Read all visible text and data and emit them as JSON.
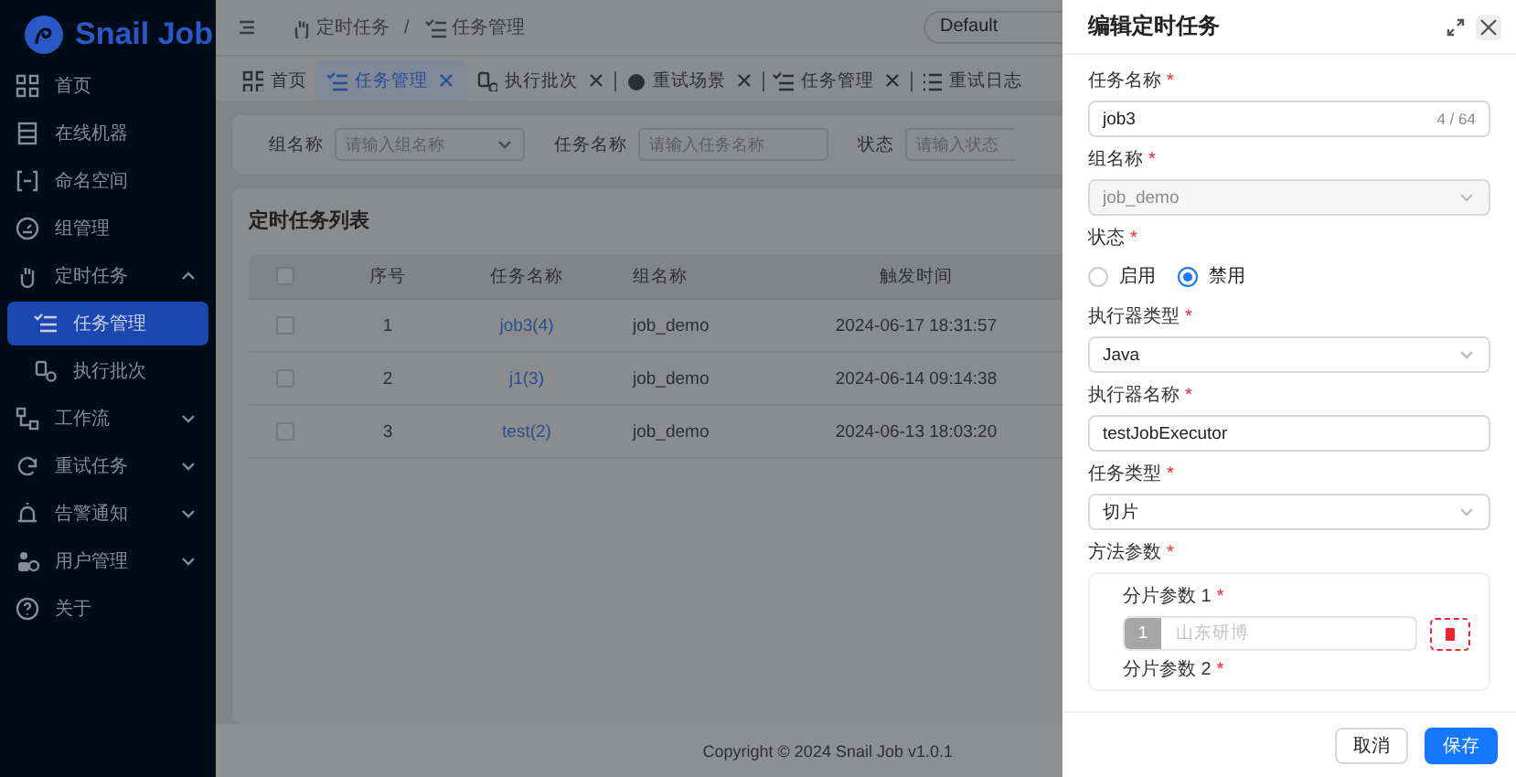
{
  "sidebar": {
    "logo": "Snail Job",
    "items": [
      {
        "label": "首页",
        "selected": false
      },
      {
        "label": "在线机器",
        "selected": false
      },
      {
        "label": "命名空间",
        "selected": false
      },
      {
        "label": "组管理",
        "selected": false
      },
      {
        "label": "定时任务",
        "selected": false,
        "expanded": true,
        "children": [
          {
            "label": "任务管理",
            "selected": true
          },
          {
            "label": "执行批次",
            "selected": false
          }
        ]
      },
      {
        "label": "工作流",
        "selected": false,
        "expanded": false
      },
      {
        "label": "重试任务",
        "selected": false,
        "expanded": false
      },
      {
        "label": "告警通知",
        "selected": false,
        "expanded": false
      },
      {
        "label": "用户管理",
        "selected": false,
        "expanded": false
      },
      {
        "label": "关于",
        "selected": false
      }
    ]
  },
  "header": {
    "breadcrumb": [
      "定时任务",
      "任务管理"
    ],
    "breadcrumb_separator": "/",
    "namespace_select": {
      "value": "Default"
    }
  },
  "tabs": [
    {
      "label": "首页",
      "selected": false,
      "closable": false
    },
    {
      "label": "任务管理",
      "selected": true,
      "closable": true
    },
    {
      "label": "执行批次",
      "selected": false,
      "closable": true
    },
    {
      "label": "重试场景",
      "selected": false,
      "closable": true
    },
    {
      "label": "任务管理",
      "selected": false,
      "closable": true
    },
    {
      "label": "重试日志",
      "selected": false,
      "closable": false
    }
  ],
  "filters": [
    {
      "label": "组名称",
      "placeholder": "请输入组名称",
      "kind": "select"
    },
    {
      "label": "任务名称",
      "placeholder": "请输入任务名称",
      "kind": "input"
    },
    {
      "label": "状态",
      "placeholder": "请输入状态",
      "kind": "input"
    }
  ],
  "table": {
    "title": "定时任务列表",
    "all_checked": false,
    "columns": [
      "序号",
      "任务名称",
      "组名称",
      "触发时间"
    ],
    "rows": [
      {
        "checked": false,
        "cells": [
          "1",
          "job3(4)",
          "job_demo",
          "2024-06-17 18:31:57"
        ]
      },
      {
        "checked": false,
        "cells": [
          "2",
          "j1(3)",
          "job_demo",
          "2024-06-14 09:14:38"
        ]
      },
      {
        "checked": false,
        "cells": [
          "3",
          "test(2)",
          "job_demo",
          "2024-06-13 18:03:20"
        ]
      }
    ]
  },
  "footer": "Copyright © 2024 Snail Job v1.0.1",
  "drawer": {
    "title": "编辑定时任务",
    "fields": [
      {
        "label": "任务名称",
        "required_mark": "*",
        "kind": "input",
        "value": "job3",
        "counter": "4 / 64",
        "disabled": false
      },
      {
        "label": "组名称",
        "required_mark": "*",
        "kind": "select",
        "value": "job_demo",
        "disabled": true
      },
      {
        "label": "状态",
        "required_mark": "*",
        "kind": "radio",
        "options": [
          {
            "label": "启用",
            "selected": false
          },
          {
            "label": "禁用",
            "selected": true
          }
        ]
      },
      {
        "label": "执行器类型",
        "required_mark": "*",
        "kind": "select",
        "value": "Java",
        "disabled": false
      },
      {
        "label": "执行器名称",
        "required_mark": "*",
        "kind": "input",
        "value": "testJobExecutor",
        "disabled": false
      },
      {
        "label": "任务类型",
        "required_mark": "*",
        "kind": "select",
        "value": "切片",
        "disabled": false
      },
      {
        "label": "方法参数",
        "required_mark": "*",
        "kind": "params",
        "params": [
          {
            "label": "分片参数 1",
            "required_mark": "*",
            "index": "1",
            "placeholder": "山东研博"
          },
          {
            "label": "分片参数 2",
            "required_mark": "*"
          }
        ]
      }
    ],
    "buttons": [
      {
        "label": "取消",
        "kind": "default"
      },
      {
        "label": "保存",
        "kind": "primary"
      }
    ]
  }
}
